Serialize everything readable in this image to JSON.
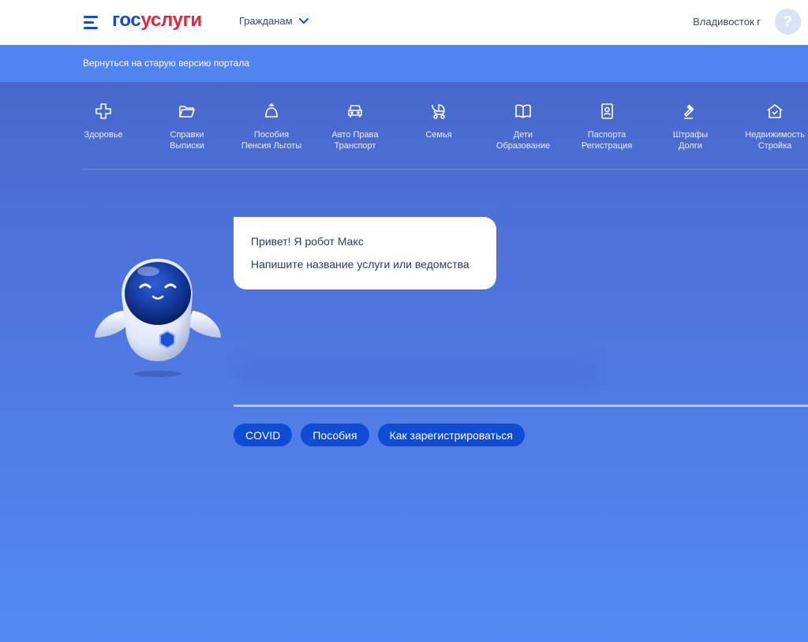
{
  "header": {
    "logo_part1": "гос",
    "logo_part2": "услуги",
    "audience": "Гражданам",
    "city": "Владивосток г",
    "help": "?"
  },
  "return_bar": {
    "text": "Вернуться на старую версию портала"
  },
  "categories": [
    {
      "icon": "plus-icon",
      "line1": "Здоровье",
      "line2": ""
    },
    {
      "icon": "folder-icon",
      "line1": "Справки",
      "line2": "Выписки"
    },
    {
      "icon": "bell-icon",
      "line1": "Пособия",
      "line2": "Пенсия Льготы"
    },
    {
      "icon": "car-icon",
      "line1": "Авто Права",
      "line2": "Транспорт"
    },
    {
      "icon": "stroller-icon",
      "line1": "Семья",
      "line2": ""
    },
    {
      "icon": "book-icon",
      "line1": "Дети",
      "line2": "Образование"
    },
    {
      "icon": "passport-icon",
      "line1": "Паспорта",
      "line2": "Регистрация"
    },
    {
      "icon": "gavel-icon",
      "line1": "Штрафы",
      "line2": "Долги"
    },
    {
      "icon": "house-icon",
      "line1": "Недвижимость",
      "line2": "Стройка"
    }
  ],
  "bot": {
    "greeting": "Привет! Я робот Макс",
    "prompt": "Напишите название услуги или ведомства"
  },
  "chips": [
    "COVID",
    "Пособия",
    "Как зарегистрироваться"
  ],
  "colors": {
    "brand_blue": "#0d4cd3",
    "brand_red": "#e3243b",
    "bar_blue": "#5284f0",
    "background": "#4f77e0"
  }
}
